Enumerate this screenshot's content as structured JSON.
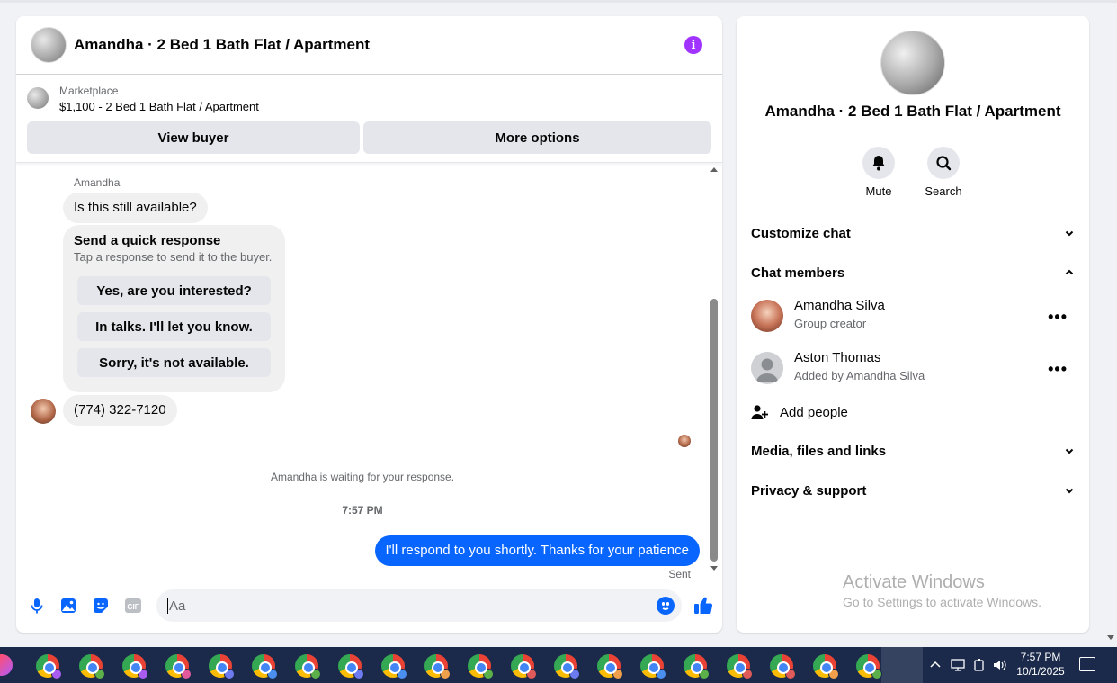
{
  "chat": {
    "title": "Amandha · 2 Bed 1 Bath Flat / Apartment",
    "marketplace_label": "Marketplace",
    "listing": "$1,100 - 2 Bed 1 Bath Flat / Apartment",
    "view_buyer": "View buyer",
    "more_options": "More options",
    "sender_name": "Amandha",
    "msg_1": "Is this still available?",
    "quick_title": "Send a quick response",
    "quick_subtitle": "Tap a response to send it to the buyer.",
    "quick_responses": [
      "Yes, are you interested?",
      "In talks. I'll let you know.",
      "Sorry, it's not available."
    ],
    "msg_2": "(774) 322-7120",
    "waiting": "Amandha is waiting for your response.",
    "time_separator": "7:57 PM",
    "outgoing": "I'll respond to you shortly. Thanks for your patience",
    "sent_status": "Sent",
    "input_placeholder": "Aa",
    "composer_icons": [
      "microphone-icon",
      "image-icon",
      "sticker-icon",
      "gif-icon",
      "emoji-icon",
      "thumbs-up-icon"
    ],
    "accent": "#0866ff",
    "info_color": "#a033ff"
  },
  "info": {
    "title": "Amandha · 2 Bed 1 Bath Flat / Apartment",
    "mute_label": "Mute",
    "search_label": "Search",
    "customize_chat": "Customize chat",
    "chat_members": "Chat members",
    "members": [
      {
        "name": "Amandha Silva",
        "role": "Group creator"
      },
      {
        "name": "Aston Thomas",
        "role": "Added by Amandha Silva"
      }
    ],
    "add_people": "Add people",
    "media_files": "Media, files and links",
    "privacy_support": "Privacy & support"
  },
  "watermark": {
    "line1": "Activate Windows",
    "line2": "Go to Settings to activate Windows."
  },
  "taskbar": {
    "time": "7:57 PM",
    "date": "10/1/2025",
    "app_icons": "chrome-icon"
  }
}
